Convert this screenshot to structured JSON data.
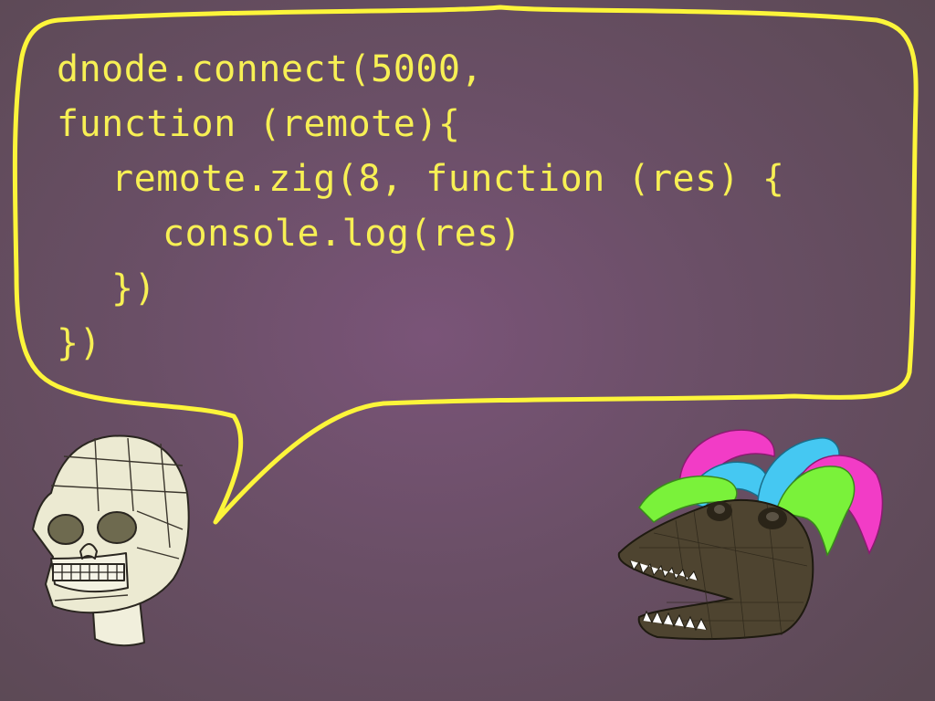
{
  "slide": {
    "speech_bubble": {
      "code_lines": [
        "dnode.connect(5000,",
        "function (remote){",
        "remote.zig(8, function (res) {",
        "console.log(res)",
        "})",
        "})"
      ]
    },
    "characters": {
      "left": "skull",
      "right": "crocodile-with-feathers"
    },
    "colors": {
      "background": "#6a4f66",
      "bubble_outline": "#fcf53a",
      "code_text": "#f7f054",
      "feather_pink": "#f23cc6",
      "feather_cyan": "#45c8f2",
      "feather_green": "#7af23a"
    }
  }
}
